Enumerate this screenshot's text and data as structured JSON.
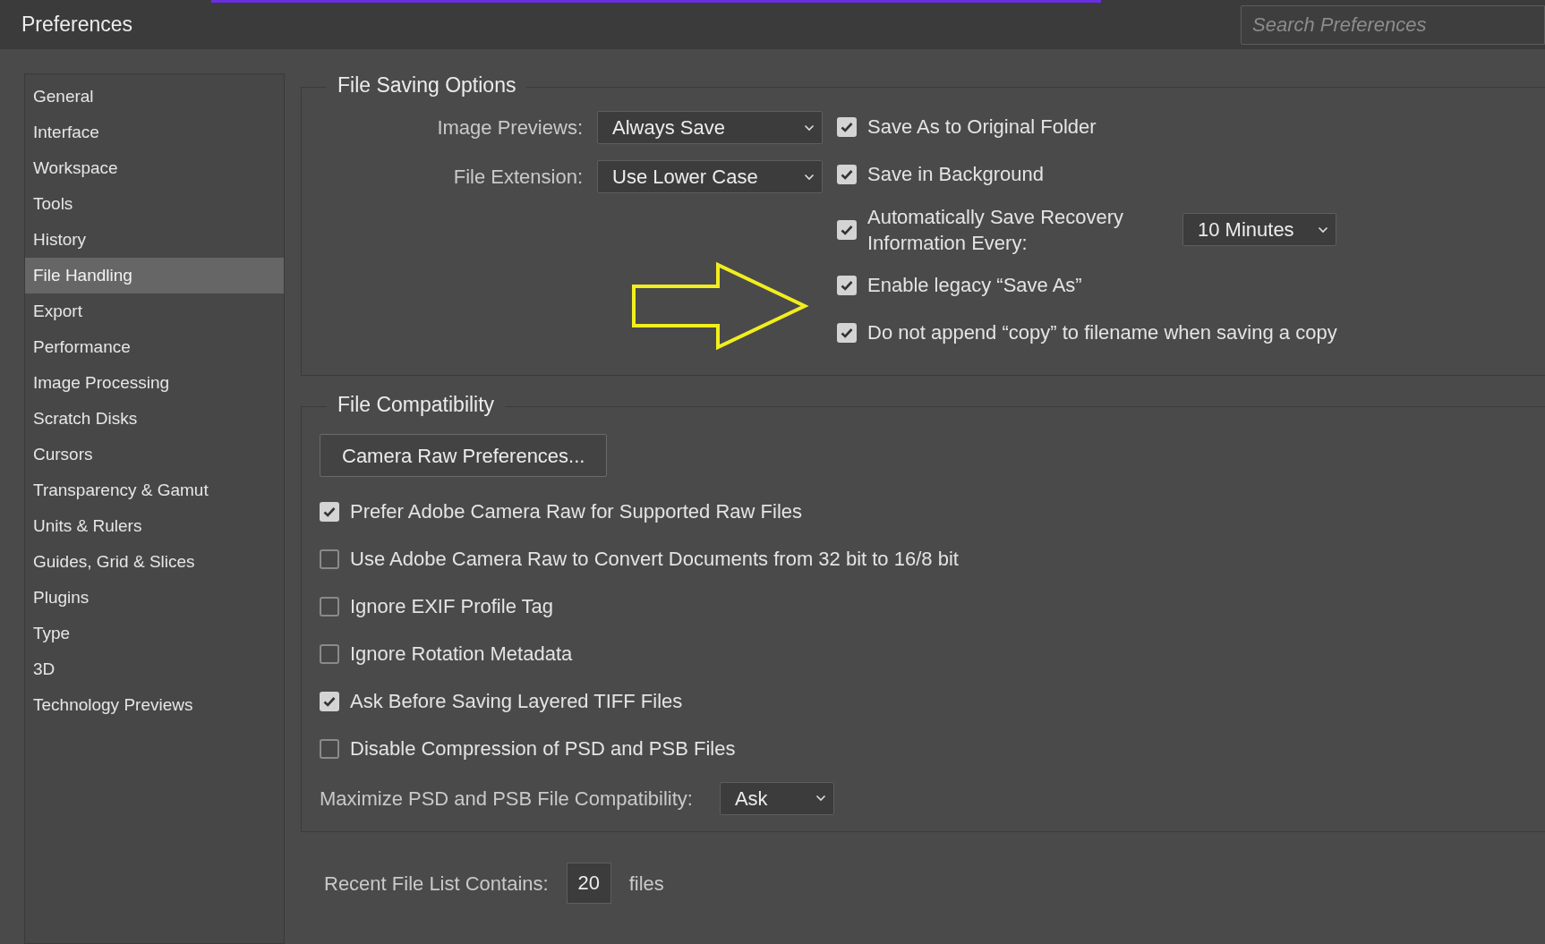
{
  "window": {
    "title": "Preferences"
  },
  "search": {
    "placeholder": "Search Preferences"
  },
  "sidebar": {
    "items": [
      {
        "label": "General",
        "selected": false
      },
      {
        "label": "Interface",
        "selected": false
      },
      {
        "label": "Workspace",
        "selected": false
      },
      {
        "label": "Tools",
        "selected": false
      },
      {
        "label": "History",
        "selected": false
      },
      {
        "label": "File Handling",
        "selected": true
      },
      {
        "label": "Export",
        "selected": false
      },
      {
        "label": "Performance",
        "selected": false
      },
      {
        "label": "Image Processing",
        "selected": false
      },
      {
        "label": "Scratch Disks",
        "selected": false
      },
      {
        "label": "Cursors",
        "selected": false
      },
      {
        "label": "Transparency & Gamut",
        "selected": false
      },
      {
        "label": "Units & Rulers",
        "selected": false
      },
      {
        "label": "Guides, Grid & Slices",
        "selected": false
      },
      {
        "label": "Plugins",
        "selected": false
      },
      {
        "label": "Type",
        "selected": false
      },
      {
        "label": "3D",
        "selected": false
      },
      {
        "label": "Technology Previews",
        "selected": false
      }
    ]
  },
  "file_saving_options": {
    "title": "File Saving Options",
    "dropdowns": [
      {
        "label": "Image Previews:",
        "value": "Always Save"
      },
      {
        "label": "File Extension:",
        "value": "Use Lower Case"
      }
    ],
    "options": [
      {
        "label": "Save As to Original Folder",
        "checked": true
      },
      {
        "label": "Save in Background",
        "checked": true
      },
      {
        "label": "Automatically Save Recovery Information Every:",
        "checked": true,
        "dropdown": "10 Minutes"
      },
      {
        "label": "Enable legacy “Save As”",
        "checked": true
      },
      {
        "label": "Do not append “copy” to filename when saving a copy",
        "checked": true
      }
    ]
  },
  "file_compatibility": {
    "title": "File Compatibility",
    "button": "Camera Raw Preferences...",
    "options": [
      {
        "label": "Prefer Adobe Camera Raw for Supported Raw Files",
        "checked": true
      },
      {
        "label": "Use Adobe Camera Raw to Convert Documents from 32 bit to 16/8 bit",
        "checked": false
      },
      {
        "label": "Ignore EXIF Profile Tag",
        "checked": false
      },
      {
        "label": "Ignore Rotation Metadata",
        "checked": false
      },
      {
        "label": "Ask Before Saving Layered TIFF Files",
        "checked": true
      },
      {
        "label": "Disable Compression of PSD and PSB Files",
        "checked": false
      }
    ],
    "maximize": {
      "label": "Maximize PSD and PSB File Compatibility:",
      "value": "Ask"
    }
  },
  "recent_files": {
    "label": "Recent File List Contains:",
    "value": "20",
    "unit": "files"
  }
}
